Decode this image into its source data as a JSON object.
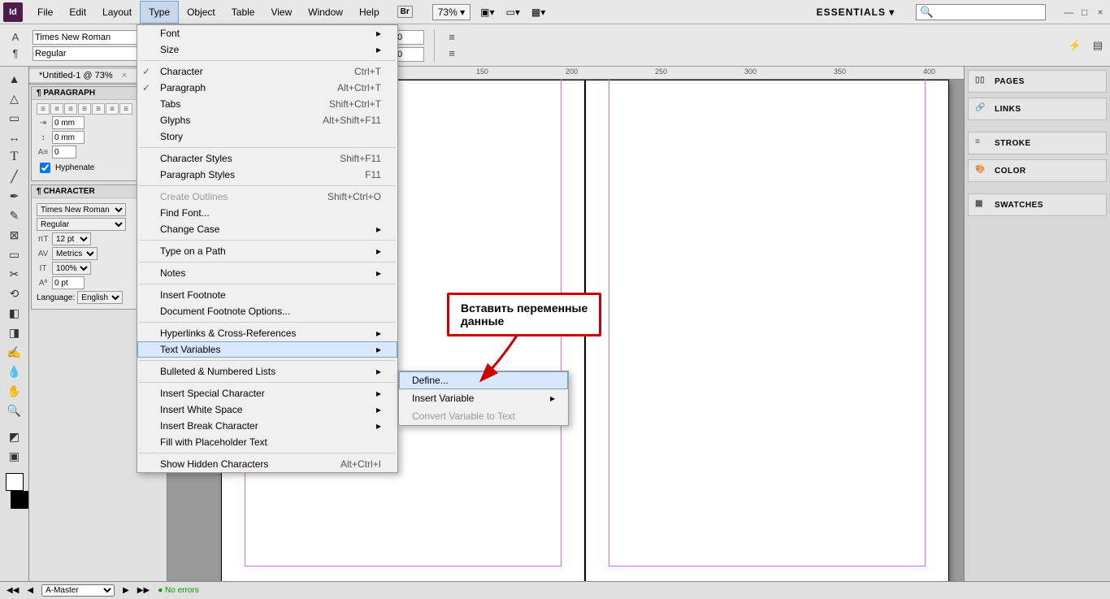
{
  "app": {
    "logo": "Id"
  },
  "menubar": {
    "items": [
      "File",
      "Edit",
      "Layout",
      "Type",
      "Object",
      "Table",
      "View",
      "Window",
      "Help"
    ],
    "active": "Type",
    "zoom": "73% ▾",
    "workspace": "ESSENTIALS ▾",
    "search_ph": "🔍"
  },
  "controlbar": {
    "font": "Times New Roman",
    "style": "Regular",
    "mm": "0 mm",
    "zero": "0"
  },
  "doctab": {
    "title": "*Untitled-1 @ 73%",
    "close": "×"
  },
  "ruler_marks": [
    "150",
    "200",
    "250",
    "300",
    "350",
    "400"
  ],
  "paragraph_panel": {
    "title": "¶ PARAGRAPH",
    "indent": "0 mm",
    "before": "0 mm",
    "dropcap": "0",
    "hyphenate": "Hyphenate"
  },
  "character_panel": {
    "title": "¶ CHARACTER",
    "font": "Times New Roman",
    "style": "Regular",
    "size": "12 pt",
    "kern": "Metrics ▾",
    "scale": "100%",
    "baseline": "0 pt",
    "lang_label": "Language:",
    "lang": "English"
  },
  "right_panels": [
    "PAGES",
    "LINKS",
    "STROKE",
    "COLOR",
    "SWATCHES"
  ],
  "statusbar": {
    "master": "A-Master",
    "errors": "No errors"
  },
  "type_menu": {
    "font": "Font",
    "size": "Size",
    "character": "Character",
    "character_sc": "Ctrl+T",
    "paragraph": "Paragraph",
    "paragraph_sc": "Alt+Ctrl+T",
    "tabs": "Tabs",
    "tabs_sc": "Shift+Ctrl+T",
    "glyphs": "Glyphs",
    "glyphs_sc": "Alt+Shift+F11",
    "story": "Story",
    "cstyles": "Character Styles",
    "cstyles_sc": "Shift+F11",
    "pstyles": "Paragraph Styles",
    "pstyles_sc": "F11",
    "outlines": "Create Outlines",
    "outlines_sc": "Shift+Ctrl+O",
    "findfont": "Find Font...",
    "changecase": "Change Case",
    "typeonpath": "Type on a Path",
    "notes": "Notes",
    "footnote": "Insert Footnote",
    "footopts": "Document Footnote Options...",
    "hyperlinks": "Hyperlinks & Cross-References",
    "textvars": "Text Variables",
    "bullets": "Bulleted & Numbered Lists",
    "specialchar": "Insert Special Character",
    "whitespace": "Insert White Space",
    "breakchar": "Insert Break Character",
    "placeholder": "Fill with Placeholder Text",
    "hidden": "Show Hidden Characters",
    "hidden_sc": "Alt+Ctrl+I"
  },
  "submenu": {
    "define": "Define...",
    "insert": "Insert Variable",
    "convert": "Convert Variable to Text"
  },
  "callout": {
    "line1": "Вставить переменные",
    "line2": "данные"
  }
}
